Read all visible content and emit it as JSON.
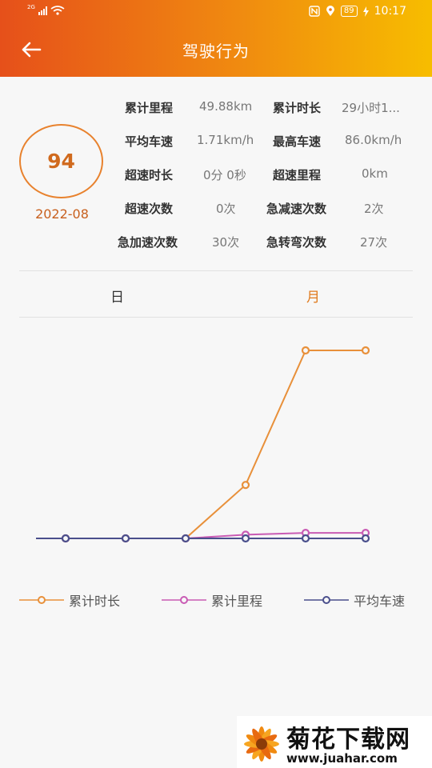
{
  "status_bar": {
    "network": "2G",
    "battery": "89",
    "time": "10:17"
  },
  "header": {
    "title": "驾驶行为",
    "back_icon": "arrow-left-icon"
  },
  "score": {
    "value": "94",
    "date": "2022-08"
  },
  "stats": [
    {
      "label": "累计里程",
      "value": "49.88km"
    },
    {
      "label": "累计时长",
      "value": "29小时1..."
    },
    {
      "label": "平均车速",
      "value": "1.71km/h"
    },
    {
      "label": "最高车速",
      "value": "86.0km/h"
    },
    {
      "label": "超速时长",
      "value": "0分 0秒"
    },
    {
      "label": "超速里程",
      "value": "0km"
    },
    {
      "label": "超速次数",
      "value": "0次"
    },
    {
      "label": "急减速次数",
      "value": "2次"
    },
    {
      "label": "急加速次数",
      "value": "30次"
    },
    {
      "label": "急转弯次数",
      "value": "27次"
    }
  ],
  "tabs": [
    {
      "label": "日",
      "active": false
    },
    {
      "label": "月",
      "active": true
    }
  ],
  "chart_data": {
    "type": "line",
    "x": [
      1,
      2,
      3,
      4,
      5,
      6
    ],
    "series": [
      {
        "name": "累计时长",
        "color": "#e8903a",
        "values": [
          0,
          0,
          0,
          29,
          102,
          102
        ]
      },
      {
        "name": "累计里程",
        "color": "#c95bb4",
        "values": [
          0,
          0,
          0,
          2,
          3,
          3
        ]
      },
      {
        "name": "平均车速",
        "color": "#4a4f8c",
        "values": [
          0,
          0,
          0,
          0,
          0,
          0
        ]
      }
    ],
    "ylim": [
      0,
      102
    ],
    "grid": false,
    "legend_position": "bottom"
  },
  "watermark": {
    "title": "菊花下载网",
    "url": "www.juahar.com"
  }
}
